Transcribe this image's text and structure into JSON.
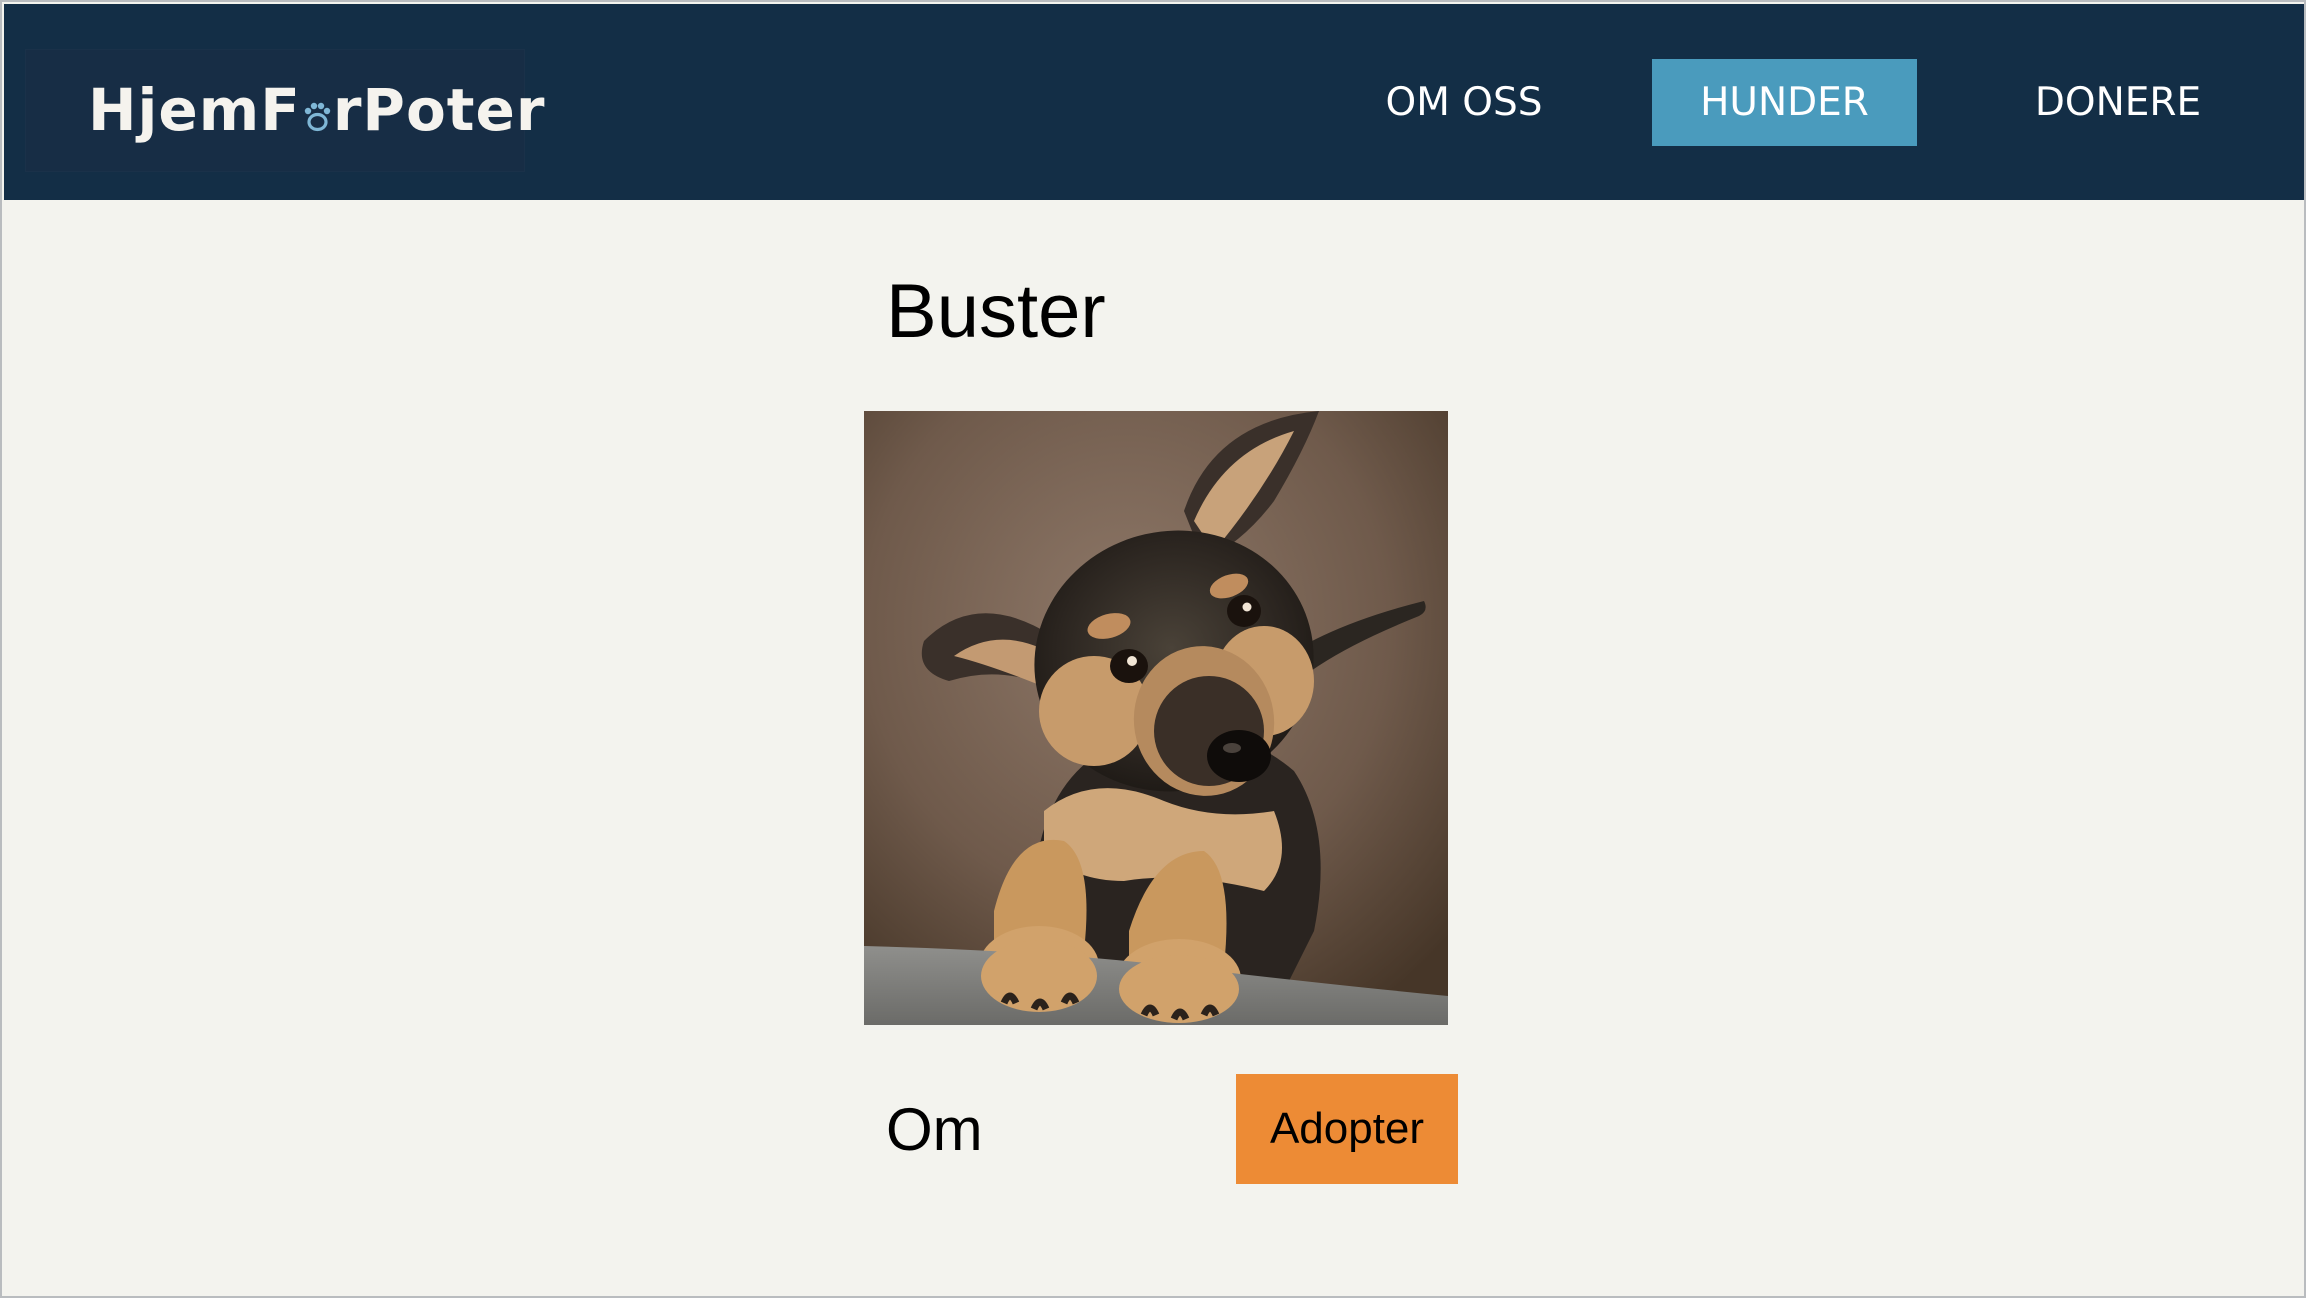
{
  "header": {
    "logo": {
      "text_before": "HjemF",
      "text_after": "rPoter",
      "icon": "paw-icon"
    },
    "nav": [
      {
        "label": "OM OSS",
        "active": false
      },
      {
        "label": "HUNDER",
        "active": true
      },
      {
        "label": "DONERE",
        "active": false
      }
    ]
  },
  "dog": {
    "name": "Buster",
    "photo_icon": "puppy-photo",
    "about_label": "Om",
    "adopt_label": "Adopter"
  },
  "colors": {
    "header_bg": "#132e46",
    "active_nav": "#4a9bbd",
    "page_bg": "#f3f3ee",
    "adopt_button": "#ed8b35"
  }
}
